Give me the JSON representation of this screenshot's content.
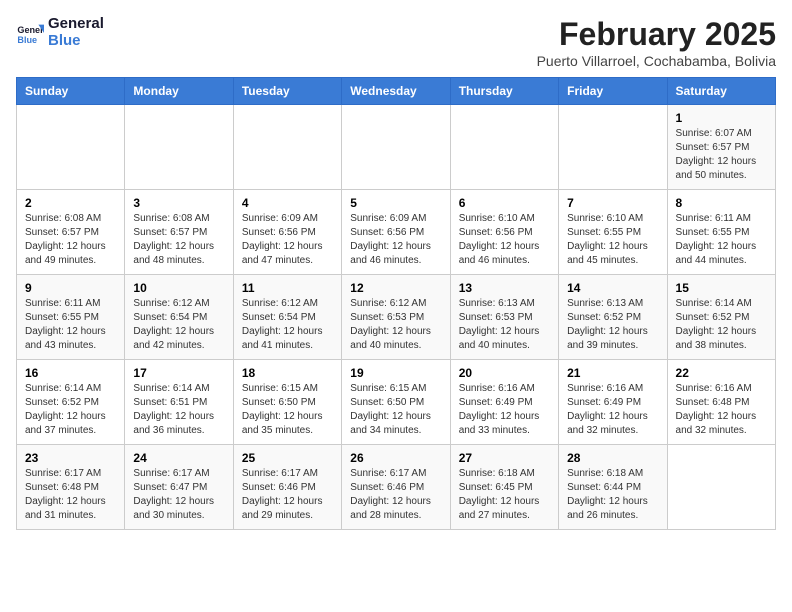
{
  "logo": {
    "line1": "General",
    "line2": "Blue"
  },
  "title": "February 2025",
  "location": "Puerto Villarroel, Cochabamba, Bolivia",
  "days_of_week": [
    "Sunday",
    "Monday",
    "Tuesday",
    "Wednesday",
    "Thursday",
    "Friday",
    "Saturday"
  ],
  "weeks": [
    [
      {
        "day": "",
        "info": ""
      },
      {
        "day": "",
        "info": ""
      },
      {
        "day": "",
        "info": ""
      },
      {
        "day": "",
        "info": ""
      },
      {
        "day": "",
        "info": ""
      },
      {
        "day": "",
        "info": ""
      },
      {
        "day": "1",
        "info": "Sunrise: 6:07 AM\nSunset: 6:57 PM\nDaylight: 12 hours and 50 minutes."
      }
    ],
    [
      {
        "day": "2",
        "info": "Sunrise: 6:08 AM\nSunset: 6:57 PM\nDaylight: 12 hours and 49 minutes."
      },
      {
        "day": "3",
        "info": "Sunrise: 6:08 AM\nSunset: 6:57 PM\nDaylight: 12 hours and 48 minutes."
      },
      {
        "day": "4",
        "info": "Sunrise: 6:09 AM\nSunset: 6:56 PM\nDaylight: 12 hours and 47 minutes."
      },
      {
        "day": "5",
        "info": "Sunrise: 6:09 AM\nSunset: 6:56 PM\nDaylight: 12 hours and 46 minutes."
      },
      {
        "day": "6",
        "info": "Sunrise: 6:10 AM\nSunset: 6:56 PM\nDaylight: 12 hours and 46 minutes."
      },
      {
        "day": "7",
        "info": "Sunrise: 6:10 AM\nSunset: 6:55 PM\nDaylight: 12 hours and 45 minutes."
      },
      {
        "day": "8",
        "info": "Sunrise: 6:11 AM\nSunset: 6:55 PM\nDaylight: 12 hours and 44 minutes."
      }
    ],
    [
      {
        "day": "9",
        "info": "Sunrise: 6:11 AM\nSunset: 6:55 PM\nDaylight: 12 hours and 43 minutes."
      },
      {
        "day": "10",
        "info": "Sunrise: 6:12 AM\nSunset: 6:54 PM\nDaylight: 12 hours and 42 minutes."
      },
      {
        "day": "11",
        "info": "Sunrise: 6:12 AM\nSunset: 6:54 PM\nDaylight: 12 hours and 41 minutes."
      },
      {
        "day": "12",
        "info": "Sunrise: 6:12 AM\nSunset: 6:53 PM\nDaylight: 12 hours and 40 minutes."
      },
      {
        "day": "13",
        "info": "Sunrise: 6:13 AM\nSunset: 6:53 PM\nDaylight: 12 hours and 40 minutes."
      },
      {
        "day": "14",
        "info": "Sunrise: 6:13 AM\nSunset: 6:52 PM\nDaylight: 12 hours and 39 minutes."
      },
      {
        "day": "15",
        "info": "Sunrise: 6:14 AM\nSunset: 6:52 PM\nDaylight: 12 hours and 38 minutes."
      }
    ],
    [
      {
        "day": "16",
        "info": "Sunrise: 6:14 AM\nSunset: 6:52 PM\nDaylight: 12 hours and 37 minutes."
      },
      {
        "day": "17",
        "info": "Sunrise: 6:14 AM\nSunset: 6:51 PM\nDaylight: 12 hours and 36 minutes."
      },
      {
        "day": "18",
        "info": "Sunrise: 6:15 AM\nSunset: 6:50 PM\nDaylight: 12 hours and 35 minutes."
      },
      {
        "day": "19",
        "info": "Sunrise: 6:15 AM\nSunset: 6:50 PM\nDaylight: 12 hours and 34 minutes."
      },
      {
        "day": "20",
        "info": "Sunrise: 6:16 AM\nSunset: 6:49 PM\nDaylight: 12 hours and 33 minutes."
      },
      {
        "day": "21",
        "info": "Sunrise: 6:16 AM\nSunset: 6:49 PM\nDaylight: 12 hours and 32 minutes."
      },
      {
        "day": "22",
        "info": "Sunrise: 6:16 AM\nSunset: 6:48 PM\nDaylight: 12 hours and 32 minutes."
      }
    ],
    [
      {
        "day": "23",
        "info": "Sunrise: 6:17 AM\nSunset: 6:48 PM\nDaylight: 12 hours and 31 minutes."
      },
      {
        "day": "24",
        "info": "Sunrise: 6:17 AM\nSunset: 6:47 PM\nDaylight: 12 hours and 30 minutes."
      },
      {
        "day": "25",
        "info": "Sunrise: 6:17 AM\nSunset: 6:46 PM\nDaylight: 12 hours and 29 minutes."
      },
      {
        "day": "26",
        "info": "Sunrise: 6:17 AM\nSunset: 6:46 PM\nDaylight: 12 hours and 28 minutes."
      },
      {
        "day": "27",
        "info": "Sunrise: 6:18 AM\nSunset: 6:45 PM\nDaylight: 12 hours and 27 minutes."
      },
      {
        "day": "28",
        "info": "Sunrise: 6:18 AM\nSunset: 6:44 PM\nDaylight: 12 hours and 26 minutes."
      },
      {
        "day": "",
        "info": ""
      }
    ]
  ]
}
